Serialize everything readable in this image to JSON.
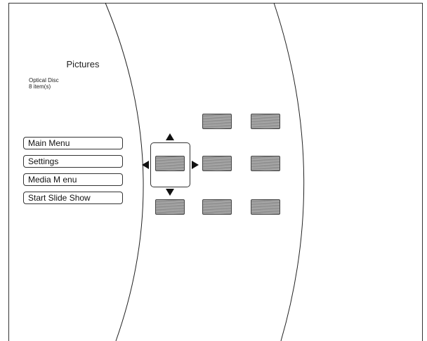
{
  "header": {
    "title": "Pictures",
    "source": "Optical Disc",
    "item_count": "8 item(s)"
  },
  "menu": {
    "items": [
      {
        "label": "Main Menu"
      },
      {
        "label": "Settings"
      },
      {
        "label": "Media M enu"
      },
      {
        "label": "Start Slide Show"
      }
    ]
  },
  "grid": {
    "thumbnails": 8,
    "selected_index": 2
  }
}
